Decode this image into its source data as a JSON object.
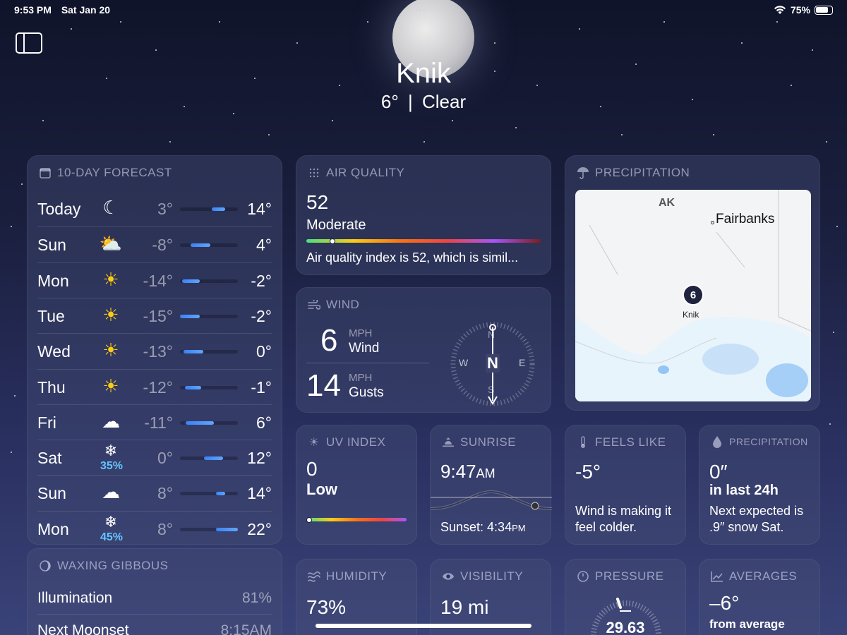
{
  "status": {
    "time": "9:53 PM",
    "date": "Sat Jan 20",
    "battery": "75%"
  },
  "location": {
    "city": "Knik",
    "temp": "6°",
    "sep": "|",
    "condition": "Clear"
  },
  "forecast": {
    "title": "10-DAY FORECAST",
    "days": [
      {
        "day": "Today",
        "icon": "moon-stars-icon",
        "glyph": "☾",
        "pct": "",
        "low": "3°",
        "high": "14°",
        "bar_start": 0.55,
        "bar_end": 0.78
      },
      {
        "day": "Sun",
        "icon": "partly-cloudy-icon",
        "glyph": "⛅",
        "pct": "",
        "low": "-8°",
        "high": "4°",
        "bar_start": 0.18,
        "bar_end": 0.52
      },
      {
        "day": "Mon",
        "icon": "sun-icon",
        "glyph": "☀",
        "pct": "",
        "low": "-14°",
        "high": "-2°",
        "bar_start": 0.04,
        "bar_end": 0.34
      },
      {
        "day": "Tue",
        "icon": "sun-icon",
        "glyph": "☀",
        "pct": "",
        "low": "-15°",
        "high": "-2°",
        "bar_start": 0.0,
        "bar_end": 0.34
      },
      {
        "day": "Wed",
        "icon": "sun-icon",
        "glyph": "☀",
        "pct": "",
        "low": "-13°",
        "high": "0°",
        "bar_start": 0.06,
        "bar_end": 0.4
      },
      {
        "day": "Thu",
        "icon": "sun-icon",
        "glyph": "☀",
        "pct": "",
        "low": "-12°",
        "high": "-1°",
        "bar_start": 0.08,
        "bar_end": 0.36
      },
      {
        "day": "Fri",
        "icon": "cloud-icon",
        "glyph": "☁",
        "pct": "",
        "low": "-11°",
        "high": "6°",
        "bar_start": 0.1,
        "bar_end": 0.58
      },
      {
        "day": "Sat",
        "icon": "snowflake-icon",
        "glyph": "❄",
        "pct": "35%",
        "low": "0°",
        "high": "12°",
        "bar_start": 0.42,
        "bar_end": 0.74
      },
      {
        "day": "Sun",
        "icon": "cloud-icon",
        "glyph": "☁",
        "pct": "",
        "low": "8°",
        "high": "14°",
        "bar_start": 0.62,
        "bar_end": 0.78
      },
      {
        "day": "Mon",
        "icon": "snowflake-icon",
        "glyph": "❄",
        "pct": "45%",
        "low": "8°",
        "high": "22°",
        "bar_start": 0.62,
        "bar_end": 1.0
      }
    ]
  },
  "moon": {
    "title": "WAXING GIBBOUS",
    "illumination_label": "Illumination",
    "illumination_value": "81%",
    "moonset_label": "Next Moonset",
    "moonset_value": "8:15AM"
  },
  "air_quality": {
    "title": "AIR QUALITY",
    "value": "52",
    "category": "Moderate",
    "description": "Air quality index is 52, which is simil...",
    "scale_position": 0.11
  },
  "wind": {
    "title": "WIND",
    "wind_value": "6",
    "wind_unit": "MPH",
    "wind_label": "Wind",
    "gust_value": "14",
    "gust_unit": "MPH",
    "gust_label": "Gusts",
    "compass": {
      "n": "N",
      "s": "S",
      "e": "E",
      "w": "W"
    }
  },
  "precip_map": {
    "title": "PRECIPITATION",
    "region": "AK",
    "city1": "Fairbanks",
    "pin_value": "6",
    "pin_label": "Knik"
  },
  "uv": {
    "title": "UV INDEX",
    "value": "0",
    "level": "Low",
    "scale_position": 0.0
  },
  "sunrise": {
    "title": "SUNRISE",
    "time": "9:47",
    "ampm": "AM",
    "sunset": "Sunset: 4:34",
    "sunset_ampm": "PM"
  },
  "feels_like": {
    "title": "FEELS LIKE",
    "value": "-5°",
    "description": "Wind is making it feel colder."
  },
  "precipitation": {
    "title": "PRECIPITATION",
    "value": "0″",
    "period": "in last 24h",
    "description": "Next expected is .9″ snow Sat."
  },
  "humidity": {
    "title": "HUMIDITY",
    "value": "73%"
  },
  "visibility": {
    "title": "VISIBILITY",
    "value": "19 mi"
  },
  "pressure": {
    "title": "PRESSURE",
    "value": "29.63"
  },
  "averages": {
    "title": "AVERAGES",
    "value": "–6°",
    "description": "from average"
  },
  "colors": {
    "accent_blue": "#60a5fa",
    "precip_pct": "#66c3ff"
  }
}
